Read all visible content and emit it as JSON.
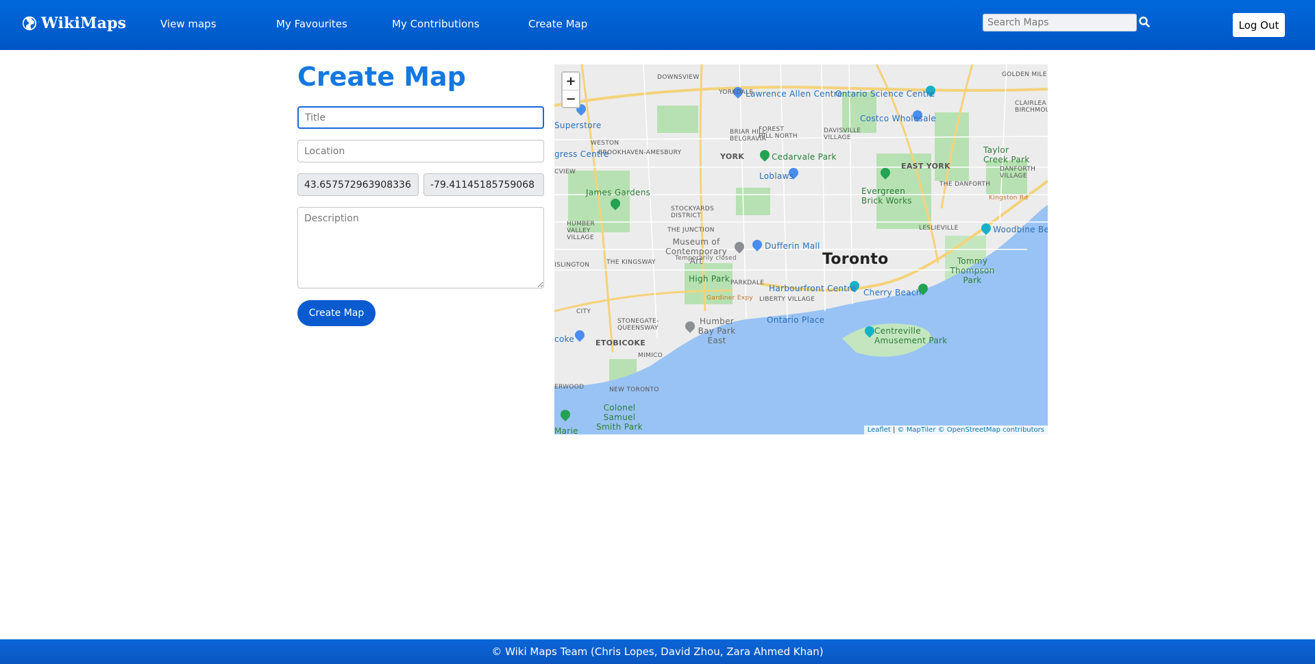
{
  "header": {
    "brand": "WikiMaps",
    "nav": [
      {
        "label": "View maps"
      },
      {
        "label": "My Favourites"
      },
      {
        "label": "My Contributions"
      },
      {
        "label": "Create Map"
      }
    ],
    "search_placeholder": "Search Maps",
    "logout_label": "Log Out"
  },
  "form": {
    "title": "Create Map",
    "title_placeholder": "Title",
    "location_placeholder": "Location",
    "latitude": "43.657572963908336",
    "longitude": "-79.41145185759068",
    "description_placeholder": "Description",
    "submit_label": "Create Map"
  },
  "map": {
    "zoom_in": "+",
    "zoom_out": "−",
    "attribution_leaflet": "Leaflet",
    "attribution_sep": " | ",
    "attribution_rest": "© MapTiler © OpenStreetMap contributors",
    "labels": {
      "downsview": "DOWNSVIEW",
      "yorkdale": "YORKDALE",
      "lawrence": "Lawrence Allen Centre",
      "science": "Ontario Science Centre",
      "golden": "GOLDEN MILE",
      "clairlea": "CLAIRLEA BIRCHMOUNT",
      "superstore": "Superstore",
      "briar": "BRIAR HILL- BELGRAVIA",
      "forest": "FOREST HILL NORTH",
      "davisville": "DAVISVILLE VILLAGE",
      "costco": "Costco Wholesale",
      "weston": "WESTON",
      "brookhaven": "BROOKHAVEN-AMESBURY",
      "york": "YORK",
      "cedarvale": "Cedarvale Park",
      "eastyork": "EAST YORK",
      "taylor": "Taylor Creek Park",
      "danforthvil": "DANFORTH VILLAGE",
      "congress": "gress Centre",
      "loblaws": "Loblaws",
      "danforth": "THE DANFORTH",
      "crview": "CVIEW",
      "jamesgardens": "James Gardens",
      "evergreen": "Evergreen Brick Works",
      "kingston": "Kingston Rd",
      "stockyards": "STOCKYARDS DISTRICT",
      "humbervalley": "HUMBER VALLEY VILLAGE",
      "junction": "THE JUNCTION",
      "leslieville": "LESLIEVILLE",
      "woodbine": "Woodbine Bea",
      "moca": "Museum of Contemporary Art",
      "tempclosed": "Temporarily closed",
      "dufferin": "Dufferin Mall",
      "toronto": "Toronto",
      "tommy": "Tommy Thompson Park",
      "islington": "ISLINGTON",
      "kingsway": "THE KINGSWAY",
      "highpark": "High Park",
      "parkdale": "PARKDALE",
      "harbourfront": "Harbourfront Centre",
      "cherry": "Cherry Beach",
      "gardiner": "Gardiner Expy",
      "liberty": "LIBERTY VILLAGE",
      "stonegate": "STONEGATE-QUEENSWAY",
      "city": "CITY",
      "ontarioplace": "Ontario Place",
      "humberbay": "Humber Bay Park East",
      "centreville": "Centreville Amusement Park",
      "etobicoke": "ETOBICOKE",
      "cokea": "coke",
      "mimico": "MIMICO",
      "newtoronto": "NEW TORONTO",
      "erwood": "ERWOOD",
      "colonel": "Colonel Samuel Smith Park",
      "marie": "Marie"
    }
  },
  "footer": {
    "text": "© Wiki Maps Team (Chris Lopes, David Zhou, Zara Ahmed Khan)"
  },
  "colors": {
    "brand_blue": "#0068db",
    "title_blue": "#1478e0",
    "button_blue": "#0a5bcf",
    "water": "#99c3f4",
    "park_green": "#a8dba6"
  }
}
